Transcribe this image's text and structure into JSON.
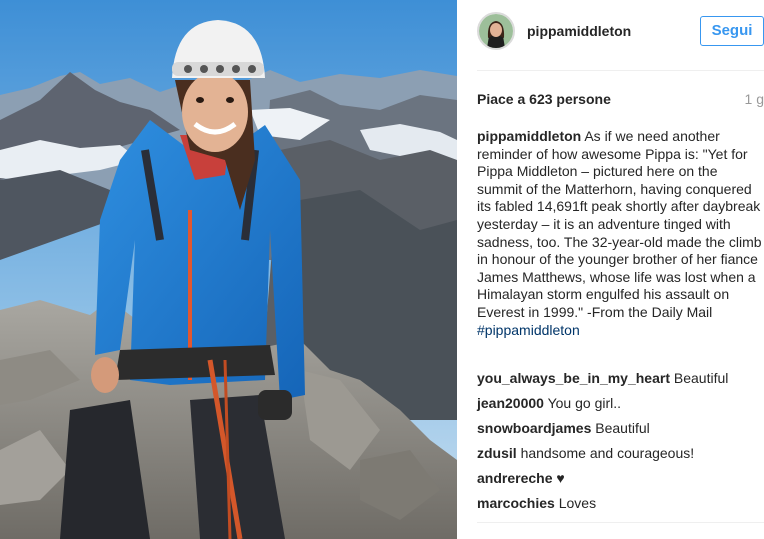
{
  "profile": {
    "username": "pippamiddleton",
    "follow_label": "Segui"
  },
  "post": {
    "likes": "Piace a 623 persone",
    "time": "1 g",
    "caption": {
      "username": "pippamiddleton",
      "text": "As if we need another reminder of how awesome Pippa is: \"Yet for Pippa Middleton – pictured here on the summit of the Matterhorn, having conquered its fabled 14,691ft peak shortly after daybreak yesterday – it is an adventure tinged with sadness, too. The 32-year-old made the climb in honour of the younger brother of her fiance James Matthews, whose life was lost when a Himalayan storm engulfed his assault on Everest in 1999.\" -From the Daily Mail",
      "hashtag": "#pippamiddleton"
    },
    "comments": [
      {
        "username": "you_always_be_in_my_heart",
        "text": "Beautiful"
      },
      {
        "username": "jean20000",
        "text": "You go girl.."
      },
      {
        "username": "snowboardjames",
        "text": "Beautiful"
      },
      {
        "username": "zdusil",
        "text": "handsome and courageous!"
      },
      {
        "username": "andrereche",
        "text": "♥"
      },
      {
        "username": "marcochies",
        "text": "Loves"
      }
    ]
  }
}
